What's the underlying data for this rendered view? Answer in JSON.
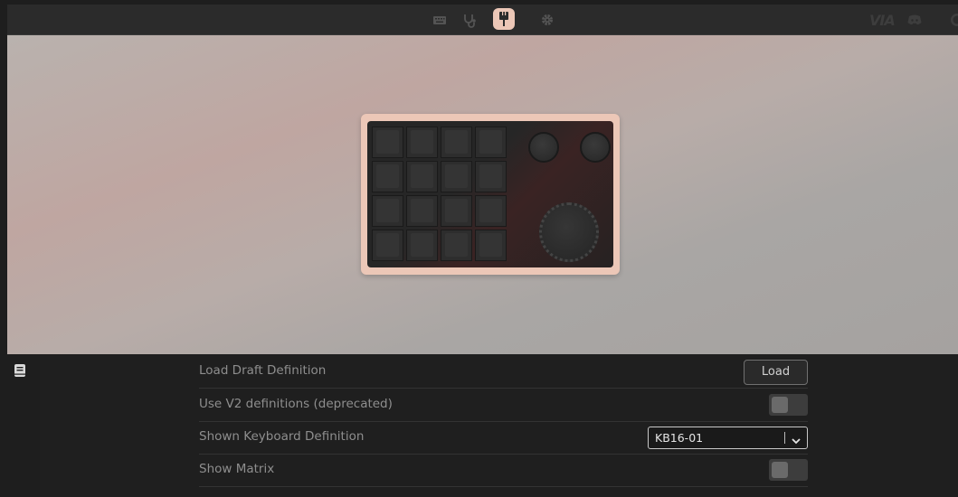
{
  "topbar": {
    "nav_icons": [
      "keyboard-icon",
      "stethoscope-icon",
      "paintbrush-icon",
      "gear-icon"
    ],
    "active_nav": "paintbrush-icon",
    "brand": "VIA",
    "right_icons": [
      "discord-icon",
      "github-icon"
    ],
    "active_color": "#ecc7b7"
  },
  "keyboard": {
    "name": "KB16-01",
    "key_rows": 4,
    "key_cols": 4,
    "knobs": 3,
    "frame_color": "#ecc7b7"
  },
  "settings": {
    "rows": [
      {
        "label": "Load Draft Definition",
        "control": "button",
        "button_label": "Load"
      },
      {
        "label": "Use V2 definitions (deprecated)",
        "control": "toggle",
        "value": false
      },
      {
        "label": "Shown Keyboard Definition",
        "control": "select",
        "value": "KB16-01"
      },
      {
        "label": "Show Matrix",
        "control": "toggle",
        "value": false
      }
    ]
  }
}
